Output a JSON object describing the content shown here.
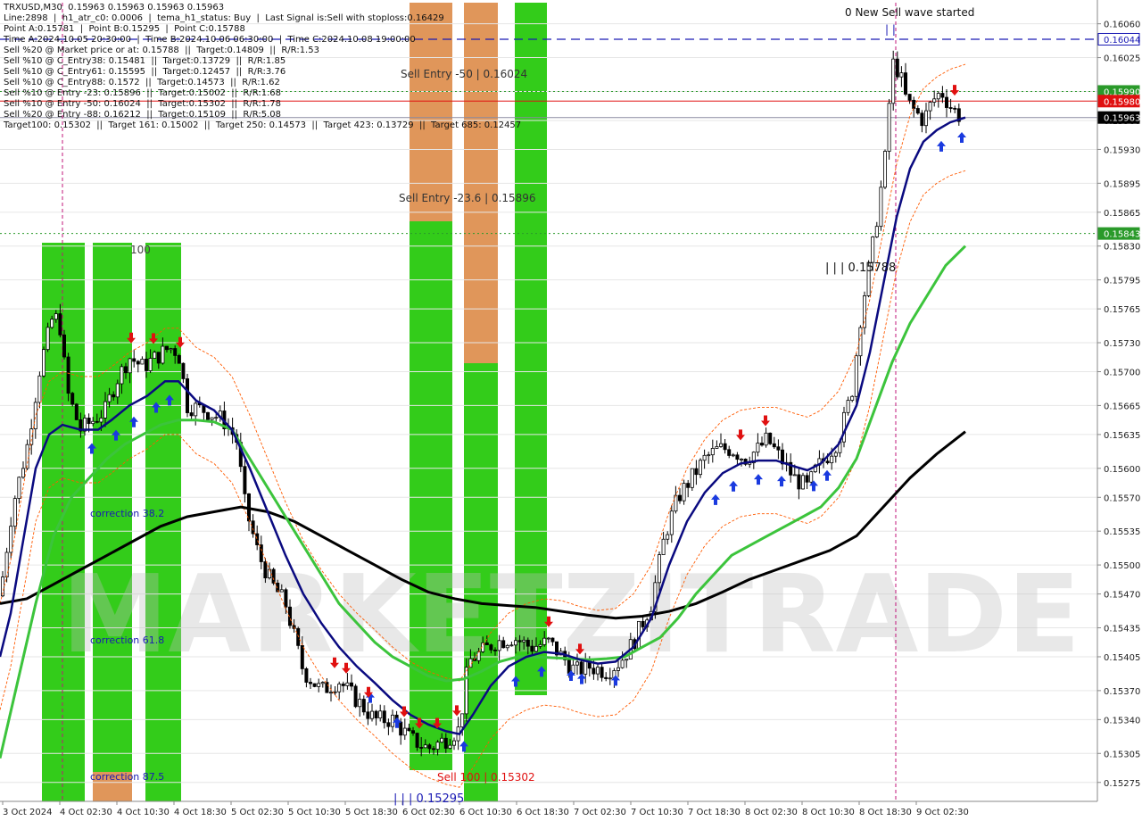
{
  "header": {
    "lines": [
      "TRXUSD,M30  0.15963 0.15963 0.15963 0.15963",
      "Line:2898  |  h1_atr_c0: 0.0006  |  tema_h1_status: Buy  |  Last Signal is:Sell with stoploss:0.16429",
      "Point A:0.15781  |  Point B:0.15295  |  Point C:0.15788",
      "Time A:2024.10.05 20:30:00  |  Time B:2024.10.06 06:30:00  |  Time C:2024.10.08 19:00:00",
      "Sell %20 @ Market price or at: 0.15788  ||  Target:0.14809  ||  R/R:1.53",
      "Sell %10 @ C_Entry38: 0.15481  ||  Target:0.13729  ||  R/R:1.85",
      "Sell %10 @ C_Entry61: 0.15595  ||  Target:0.12457  ||  R/R:3.76",
      "Sell %10 @ C_Entry88: 0.1572  ||  Target:0.14573  ||  R/R:1.62",
      "Sell %10 @ Entry -23: 0.15896  ||  Target:0.15002  ||  R/R:1.68",
      "Sell %10 @ Entry -50: 0.16024  ||  Target:0.15302  ||  R/R:1.78",
      "Sell %20 @ Entry -88: 0.16212  ||  Target:0.15109  ||  R/R:5.08",
      "Target100: 0.15302  ||  Target 161: 0.15002  ||  Target 250: 0.14573  ||  Target 423: 0.13729  ||  Target 685: 0.12457"
    ]
  },
  "watermark": "MARKETZITRADE",
  "annotations": {
    "new_sell_wave": "0 New Sell wave started",
    "wave_marker": "| |",
    "sell_entry_50": "Sell Entry -50 | 0.16024",
    "sell_entry_23": "Sell Entry -23.6 | 0.15896",
    "point_c": "| | | 0.15788",
    "label_100": "100",
    "correction_382": "correction 38.2",
    "correction_618": "correction 61.8",
    "correction_875": "correction 87.5",
    "sell_100": "Sell 100 | 0.15302",
    "point_b": "| | | 0.15295"
  },
  "colors": {
    "background": "#ffffff",
    "zone_green": "#33cc1a",
    "zone_orange": "#e0965a",
    "zone_light_orange": "#e8a86a",
    "tema_blue": "#0a0a80",
    "ma_green": "#3cc43c",
    "ma_black": "#000000",
    "envelope_orange": "#ff5a00",
    "level_blue": "#1a1ab4",
    "level_red": "#e01010",
    "level_green": "#2a9a2a",
    "buy_arrow": "#1a3adf",
    "sell_arrow": "#e01010"
  },
  "price_labels": {
    "level_top": "0.16044",
    "level_green_1": "0.15990",
    "level_red": "0.15980",
    "last_price": "0.15963",
    "level_green_2": "0.15843"
  },
  "chart_data": {
    "type": "candlestick",
    "symbol": "TRXUSD",
    "timeframe": "M30",
    "ylim": [
      0.1526,
      0.1608
    ],
    "y_ticks": [
      "0.16060",
      "0.16025",
      "0.15990",
      "0.15960",
      "0.15930",
      "0.15895",
      "0.15865",
      "0.15830",
      "0.15795",
      "0.15765",
      "0.15730",
      "0.15700",
      "0.15665",
      "0.15635",
      "0.15600",
      "0.15570",
      "0.15535",
      "0.15500",
      "0.15470",
      "0.15435",
      "0.15405",
      "0.15370",
      "0.15340",
      "0.15305",
      "0.15275"
    ],
    "x_ticks": [
      "3 Oct 2024",
      "4 Oct 02:30",
      "4 Oct 10:30",
      "4 Oct 18:30",
      "5 Oct 02:30",
      "5 Oct 10:30",
      "5 Oct 18:30",
      "6 Oct 02:30",
      "6 Oct 10:30",
      "6 Oct 18:30",
      "7 Oct 02:30",
      "7 Oct 10:30",
      "7 Oct 18:30",
      "8 Oct 02:30",
      "8 Oct 10:30",
      "8 Oct 18:30",
      "9 Oct 02:30"
    ],
    "close_path": [
      [
        0,
        0.15468
      ],
      [
        14,
        0.1556
      ],
      [
        30,
        0.1562
      ],
      [
        45,
        0.15705
      ],
      [
        60,
        0.1576
      ],
      [
        68,
        0.15745
      ],
      [
        75,
        0.1568
      ],
      [
        90,
        0.1564
      ],
      [
        105,
        0.1565
      ],
      [
        118,
        0.1566
      ],
      [
        130,
        0.1569
      ],
      [
        145,
        0.15715
      ],
      [
        160,
        0.15705
      ],
      [
        175,
        0.15715
      ],
      [
        190,
        0.15725
      ],
      [
        200,
        0.1572
      ],
      [
        210,
        0.15665
      ],
      [
        230,
        0.1566
      ],
      [
        250,
        0.1565
      ],
      [
        265,
        0.1563
      ],
      [
        275,
        0.1556
      ],
      [
        290,
        0.1551
      ],
      [
        305,
        0.1548
      ],
      [
        320,
        0.1546
      ],
      [
        340,
        0.1539
      ],
      [
        360,
        0.1537
      ],
      [
        380,
        0.1538
      ],
      [
        400,
        0.1536
      ],
      [
        420,
        0.1534
      ],
      [
        440,
        0.1534
      ],
      [
        460,
        0.1532
      ],
      [
        480,
        0.1531
      ],
      [
        500,
        0.1532
      ],
      [
        515,
        0.1533
      ],
      [
        525,
        0.154
      ],
      [
        540,
        0.1541
      ],
      [
        555,
        0.1542
      ],
      [
        575,
        0.15425
      ],
      [
        595,
        0.15415
      ],
      [
        615,
        0.1542
      ],
      [
        630,
        0.15405
      ],
      [
        645,
        0.1539
      ],
      [
        660,
        0.15395
      ],
      [
        680,
        0.1539
      ],
      [
        695,
        0.154
      ],
      [
        710,
        0.1542
      ],
      [
        730,
        0.1546
      ],
      [
        745,
        0.1553
      ],
      [
        760,
        0.1557
      ],
      [
        775,
        0.1559
      ],
      [
        790,
        0.1561
      ],
      [
        805,
        0.1562
      ],
      [
        820,
        0.1562
      ],
      [
        835,
        0.1561
      ],
      [
        850,
        0.1562
      ],
      [
        860,
        0.1563
      ],
      [
        875,
        0.1561
      ],
      [
        890,
        0.1559
      ],
      [
        905,
        0.1558
      ],
      [
        915,
        0.156
      ],
      [
        925,
        0.1561
      ],
      [
        940,
        0.1563
      ],
      [
        955,
        0.1568
      ],
      [
        965,
        0.1576
      ],
      [
        980,
        0.1584
      ],
      [
        992,
        0.1592
      ],
      [
        1000,
        0.1602
      ],
      [
        1008,
        0.1601
      ],
      [
        1016,
        0.1598
      ],
      [
        1025,
        0.1597
      ],
      [
        1035,
        0.1596
      ],
      [
        1045,
        0.1598
      ],
      [
        1055,
        0.1599
      ],
      [
        1065,
        0.15975
      ],
      [
        1075,
        0.15965
      ],
      [
        1080,
        0.15963
      ]
    ],
    "tema_path": [
      [
        0,
        0.15405
      ],
      [
        12,
        0.1545
      ],
      [
        25,
        0.1552
      ],
      [
        40,
        0.156
      ],
      [
        55,
        0.15635
      ],
      [
        70,
        0.15645
      ],
      [
        90,
        0.1564
      ],
      [
        110,
        0.1564
      ],
      [
        125,
        0.1565
      ],
      [
        145,
        0.15665
      ],
      [
        165,
        0.15675
      ],
      [
        185,
        0.1569
      ],
      [
        200,
        0.1569
      ],
      [
        220,
        0.1567
      ],
      [
        240,
        0.1566
      ],
      [
        260,
        0.1564
      ],
      [
        280,
        0.156
      ],
      [
        300,
        0.15555
      ],
      [
        320,
        0.1551
      ],
      [
        340,
        0.1547
      ],
      [
        360,
        0.1544
      ],
      [
        380,
        0.15415
      ],
      [
        400,
        0.15395
      ],
      [
        420,
        0.15378
      ],
      [
        440,
        0.1536
      ],
      [
        460,
        0.15345
      ],
      [
        480,
        0.15335
      ],
      [
        500,
        0.15328
      ],
      [
        515,
        0.15325
      ],
      [
        530,
        0.15345
      ],
      [
        550,
        0.15375
      ],
      [
        570,
        0.15395
      ],
      [
        590,
        0.15405
      ],
      [
        610,
        0.1541
      ],
      [
        630,
        0.15408
      ],
      [
        650,
        0.15402
      ],
      [
        670,
        0.15398
      ],
      [
        690,
        0.154
      ],
      [
        710,
        0.15415
      ],
      [
        730,
        0.15445
      ],
      [
        750,
        0.155
      ],
      [
        770,
        0.15545
      ],
      [
        790,
        0.15575
      ],
      [
        810,
        0.15595
      ],
      [
        830,
        0.15605
      ],
      [
        850,
        0.15608
      ],
      [
        870,
        0.15608
      ],
      [
        890,
        0.15602
      ],
      [
        905,
        0.15598
      ],
      [
        920,
        0.15605
      ],
      [
        940,
        0.15625
      ],
      [
        960,
        0.15665
      ],
      [
        975,
        0.1572
      ],
      [
        990,
        0.1579
      ],
      [
        1005,
        0.1586
      ],
      [
        1020,
        0.1591
      ],
      [
        1035,
        0.15938
      ],
      [
        1050,
        0.1595
      ],
      [
        1065,
        0.15958
      ],
      [
        1082,
        0.15963
      ]
    ],
    "ma_green_path": [
      [
        0,
        0.153
      ],
      [
        20,
        0.1538
      ],
      [
        40,
        0.1546
      ],
      [
        60,
        0.1553
      ],
      [
        80,
        0.1557
      ],
      [
        100,
        0.1559
      ],
      [
        120,
        0.1561
      ],
      [
        140,
        0.15625
      ],
      [
        160,
        0.15635
      ],
      [
        180,
        0.15645
      ],
      [
        200,
        0.1565
      ],
      [
        220,
        0.1565
      ],
      [
        240,
        0.15648
      ],
      [
        260,
        0.1564
      ],
      [
        280,
        0.1561
      ],
      [
        300,
        0.1558
      ],
      [
        320,
        0.1555
      ],
      [
        340,
        0.1552
      ],
      [
        360,
        0.1549
      ],
      [
        380,
        0.1546
      ],
      [
        400,
        0.1544
      ],
      [
        420,
        0.1542
      ],
      [
        440,
        0.15405
      ],
      [
        460,
        0.15395
      ],
      [
        480,
        0.15385
      ],
      [
        500,
        0.1538
      ],
      [
        520,
        0.15382
      ],
      [
        540,
        0.1539
      ],
      [
        560,
        0.154
      ],
      [
        580,
        0.15405
      ],
      [
        600,
        0.15405
      ],
      [
        620,
        0.15404
      ],
      [
        640,
        0.15403
      ],
      [
        660,
        0.15402
      ],
      [
        680,
        0.15403
      ],
      [
        700,
        0.15405
      ],
      [
        720,
        0.15415
      ],
      [
        740,
        0.15425
      ],
      [
        760,
        0.15445
      ],
      [
        780,
        0.1547
      ],
      [
        800,
        0.1549
      ],
      [
        820,
        0.1551
      ],
      [
        840,
        0.1552
      ],
      [
        860,
        0.1553
      ],
      [
        880,
        0.1554
      ],
      [
        900,
        0.1555
      ],
      [
        920,
        0.1556
      ],
      [
        940,
        0.1558
      ],
      [
        960,
        0.1561
      ],
      [
        980,
        0.1566
      ],
      [
        1000,
        0.1571
      ],
      [
        1020,
        0.1575
      ],
      [
        1040,
        0.1578
      ],
      [
        1060,
        0.1581
      ],
      [
        1082,
        0.1583
      ]
    ],
    "ma_black_path": [
      [
        0,
        0.1546
      ],
      [
        30,
        0.15465
      ],
      [
        60,
        0.1548
      ],
      [
        90,
        0.15495
      ],
      [
        120,
        0.1551
      ],
      [
        150,
        0.15525
      ],
      [
        180,
        0.1554
      ],
      [
        210,
        0.1555
      ],
      [
        240,
        0.15555
      ],
      [
        270,
        0.1556
      ],
      [
        300,
        0.15555
      ],
      [
        330,
        0.15545
      ],
      [
        360,
        0.1553
      ],
      [
        390,
        0.15515
      ],
      [
        420,
        0.155
      ],
      [
        450,
        0.15485
      ],
      [
        480,
        0.15472
      ],
      [
        510,
        0.15465
      ],
      [
        540,
        0.1546
      ],
      [
        570,
        0.15458
      ],
      [
        600,
        0.15456
      ],
      [
        630,
        0.15452
      ],
      [
        660,
        0.15448
      ],
      [
        690,
        0.15445
      ],
      [
        720,
        0.15447
      ],
      [
        750,
        0.15452
      ],
      [
        780,
        0.1546
      ],
      [
        810,
        0.15472
      ],
      [
        840,
        0.15485
      ],
      [
        870,
        0.15495
      ],
      [
        900,
        0.15505
      ],
      [
        930,
        0.15515
      ],
      [
        960,
        0.1553
      ],
      [
        990,
        0.1556
      ],
      [
        1020,
        0.1559
      ],
      [
        1050,
        0.15615
      ],
      [
        1082,
        0.15638
      ]
    ],
    "levels": [
      {
        "price": 0.16044,
        "style": "dashed-blue"
      },
      {
        "price": 0.1599,
        "style": "dotted-green"
      },
      {
        "price": 0.1598,
        "style": "solid-red"
      },
      {
        "price": 0.15963,
        "style": "solid-grey"
      },
      {
        "price": 0.15843,
        "style": "dotted-green"
      }
    ],
    "buy_arrows_x": [
      103,
      130,
      150,
      175,
      190,
      415,
      445,
      520,
      578,
      607,
      640,
      652,
      690,
      802,
      822,
      850,
      876,
      912,
      927,
      1055,
      1078
    ],
    "sell_arrows_x": [
      147,
      172,
      202,
      375,
      388,
      413,
      453,
      470,
      490,
      512,
      615,
      650,
      830,
      858,
      1070
    ]
  }
}
